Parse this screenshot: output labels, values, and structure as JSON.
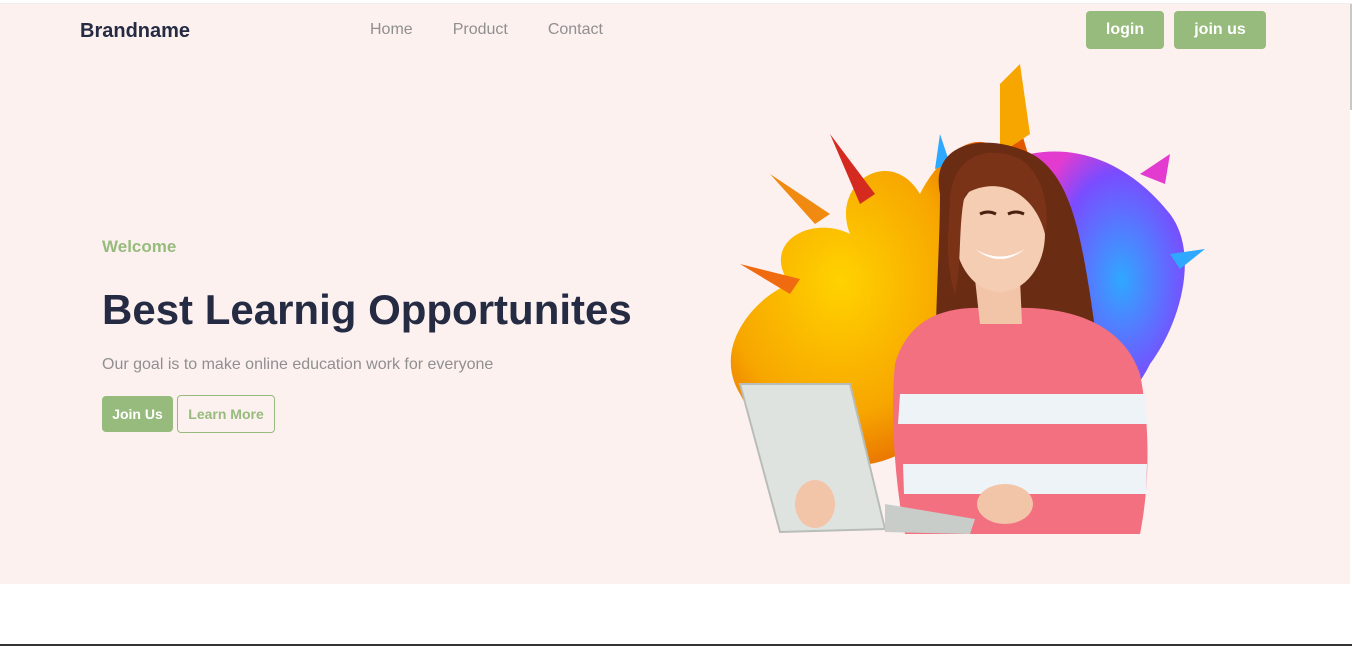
{
  "header": {
    "brand": "Brandname",
    "nav": [
      "Home",
      "Product",
      "Contact"
    ],
    "login_label": "login",
    "join_label": "join us"
  },
  "hero": {
    "eyebrow": "Welcome",
    "title": "Best Learnig Opportunites",
    "subtitle": "Our goal is to make online education work for everyone",
    "primary_button": "Join Us",
    "secondary_button": "Learn More",
    "image_icon": "student-with-laptop-illustration"
  },
  "colors": {
    "accent": "#96bb7c",
    "heading": "#252b42",
    "muted": "#8f8f8f",
    "hero_bg": "#fdf1f0"
  }
}
